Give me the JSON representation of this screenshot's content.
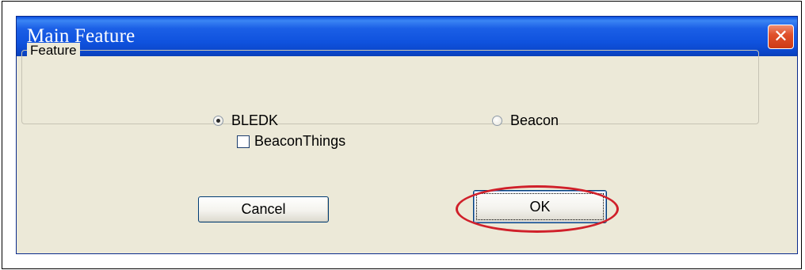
{
  "dialog": {
    "title": "Main Feature",
    "close_icon": "close-icon",
    "groupbox_label": "Feature",
    "options": {
      "bledk": {
        "label": "BLEDK",
        "selected": true
      },
      "beacon": {
        "label": "Beacon",
        "selected": false
      }
    },
    "checkbox": {
      "label": "BeaconThings",
      "checked": false
    },
    "buttons": {
      "cancel": "Cancel",
      "ok": "OK"
    }
  },
  "annotation": {
    "color": "#d0202a",
    "target": "ok-button"
  },
  "colors": {
    "titlebar": "#0f52de",
    "dialog_face": "#ece9d8",
    "close_button": "#e0512c"
  }
}
